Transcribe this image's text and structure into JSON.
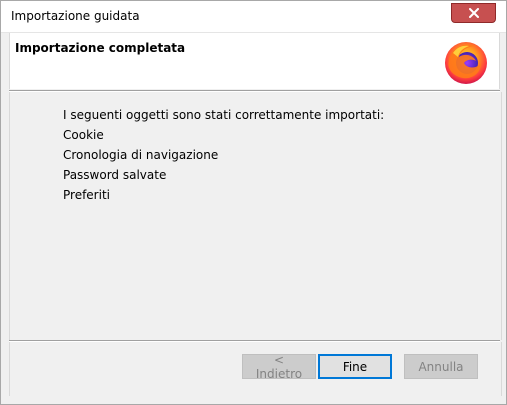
{
  "window": {
    "title": "Importazione guidata",
    "close_icon": "close-icon"
  },
  "header": {
    "title": "Importazione completata",
    "logo_icon": "firefox-logo"
  },
  "content": {
    "intro": "I seguenti oggetti sono stati correttamente importati:",
    "items": [
      "Cookie",
      "Cronologia di navigazione",
      "Password salvate",
      "Preferiti"
    ]
  },
  "buttons": {
    "back": "< Indietro",
    "finish": "Fine",
    "cancel": "Annulla"
  },
  "colors": {
    "close_button": "#c75050",
    "default_button_border": "#0078d7"
  }
}
